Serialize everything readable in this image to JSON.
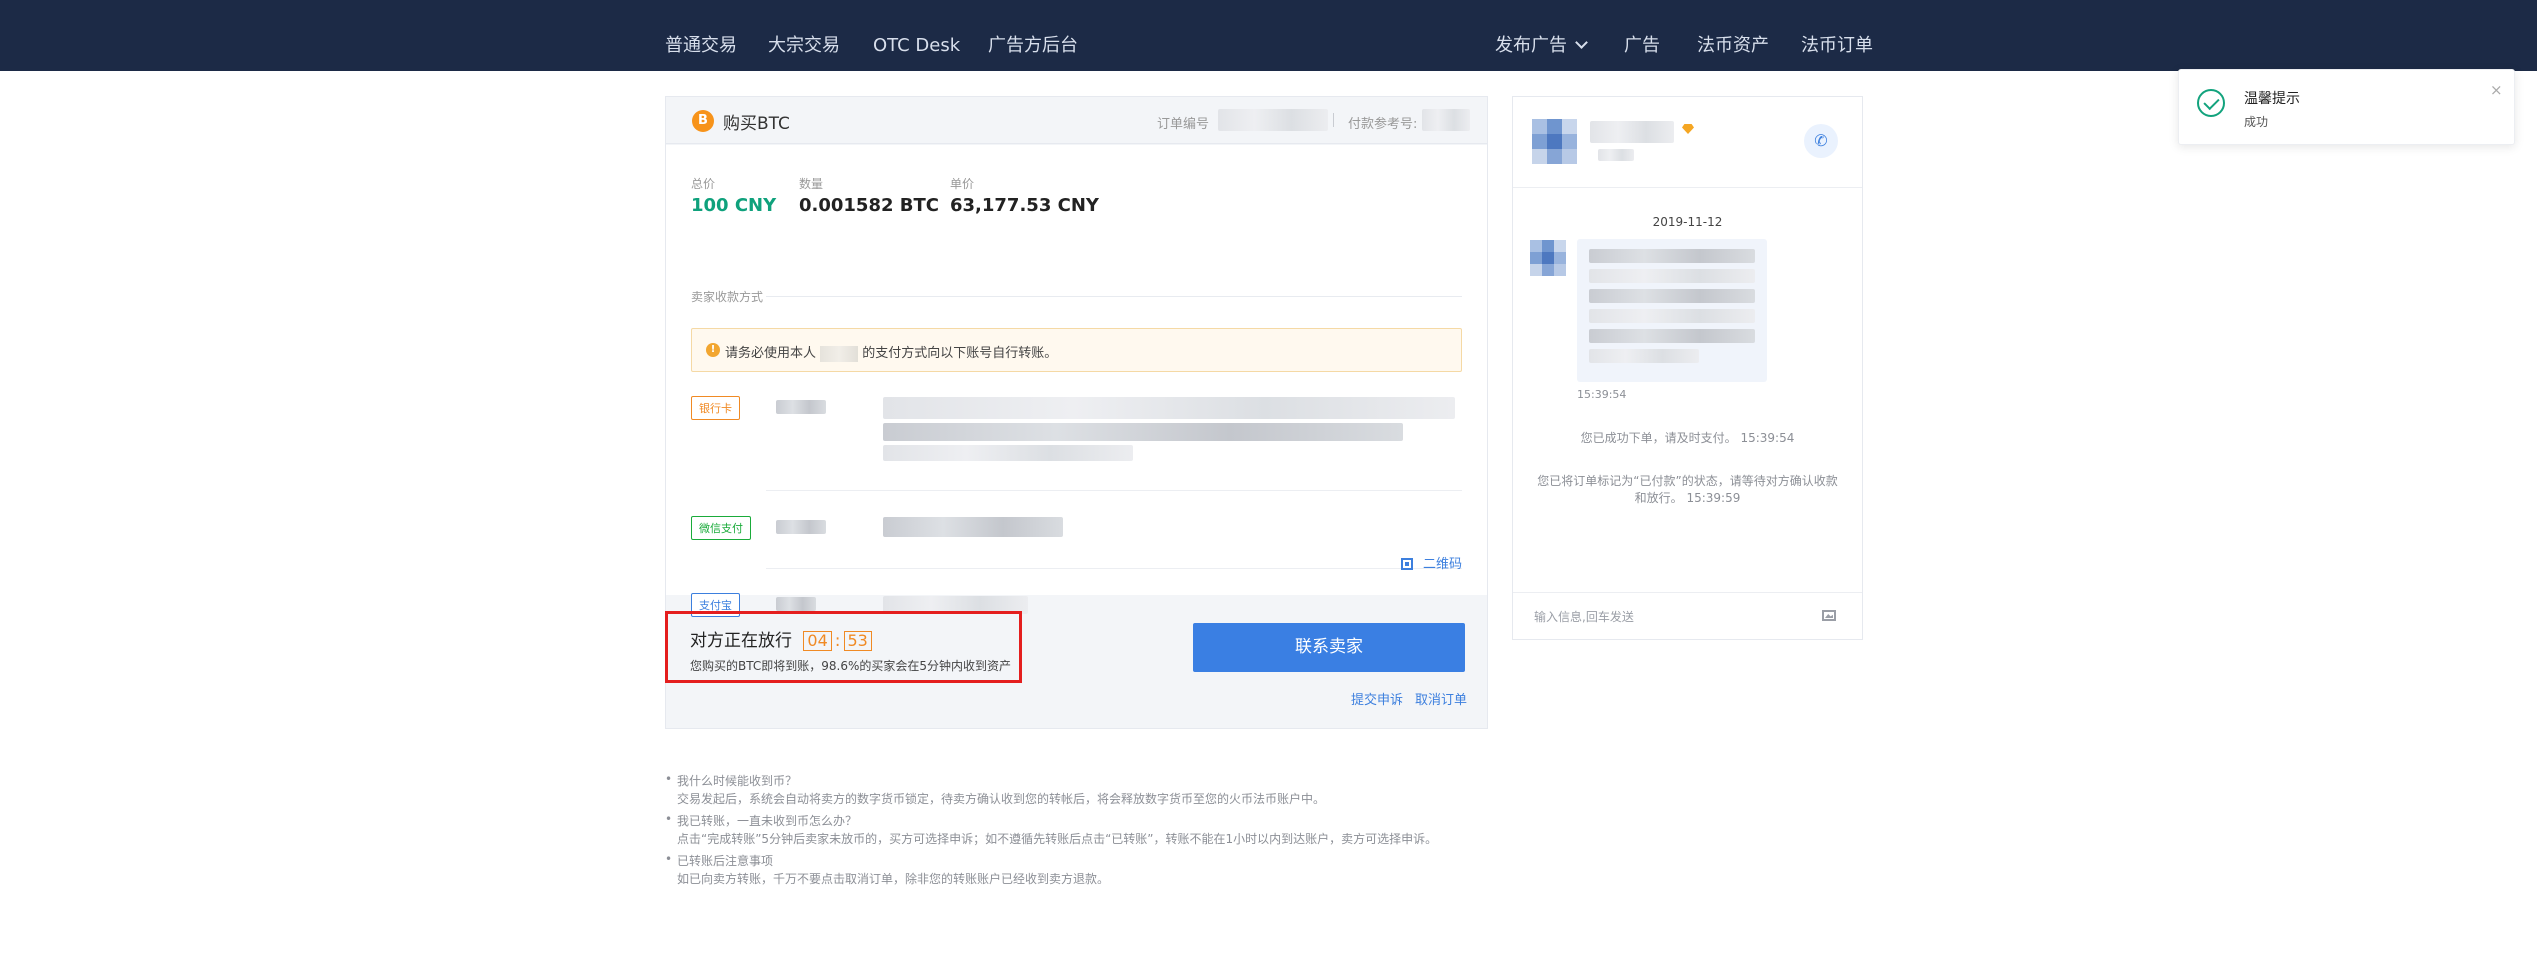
{
  "nav": {
    "left": [
      "普通交易",
      "大宗交易",
      "OTC Desk",
      "广告方后台"
    ],
    "right": [
      "发布广告",
      "广告",
      "法币资产",
      "法币订单"
    ]
  },
  "order": {
    "title": "购买BTC",
    "order_no_label": "订单编号",
    "payment_ref_label": "付款参考号:",
    "total_label": "总价",
    "total_value": "100 CNY",
    "amount_label": "数量",
    "amount_value": "0.001582 BTC",
    "unit_label": "单价",
    "unit_value": "63,177.53 CNY",
    "seller_payment_label": "卖家收款方式",
    "notice_before": "请务必使用本人",
    "notice_after": "的支付方式向以下账号自行转账。",
    "payment_methods": [
      {
        "tag": "银行卡",
        "color": "#f08a24"
      },
      {
        "tag": "微信支付",
        "color": "#1aab3a"
      },
      {
        "tag": "支付宝",
        "color": "#3c7fde"
      }
    ],
    "qr_code_label": "二维码",
    "status_title": "对方正在放行",
    "timer_minutes": "04",
    "timer_seconds": "53",
    "status_sub": "您购买的BTC即将到账，98.6%的买家会在5分钟内收到资产",
    "contact_button": "联系卖家",
    "appeal_link": "提交申诉",
    "cancel_link": "取消订单"
  },
  "faq": [
    {
      "q": "我什么时候能收到币？",
      "a": "交易发起后，系统会自动将卖方的数字货币锁定，待卖方确认收到您的转帐后，将会释放数字货币至您的火币法币账户中。"
    },
    {
      "q": "我已转账，一直未收到币怎么办？",
      "a": "点击“完成转账”5分钟后卖家未放币的，买方可选择申诉；如不遵循先转账后点击“已转账”，转账不能在1小时以内到达账户，卖方可选择申诉。"
    },
    {
      "q": "已转账后注意事项",
      "a": "如已向卖方转账，千万不要点击取消订单，除非您的转账账户已经收到卖方退款。"
    }
  ],
  "chat": {
    "date": "2019-11-12",
    "message_time": "15:39:54",
    "system_messages": [
      {
        "text": "您已成功下单，请及时支付。",
        "time": "15:39:54"
      },
      {
        "text": "您已将订单标记为“已付款”的状态，请等待对方确认收款和放行。",
        "time": "15:39:59"
      }
    ],
    "input_placeholder": "输入信息,回车发送"
  },
  "toast": {
    "title": "温馨提示",
    "message": "成功",
    "close": "×"
  },
  "colors": {
    "nav_bg": "#1c2a46",
    "accent_blue": "#3a7fe3",
    "price_green": "#0fa17c",
    "timer_orange": "#f08a24",
    "highlight_red": "#e41e1e"
  }
}
